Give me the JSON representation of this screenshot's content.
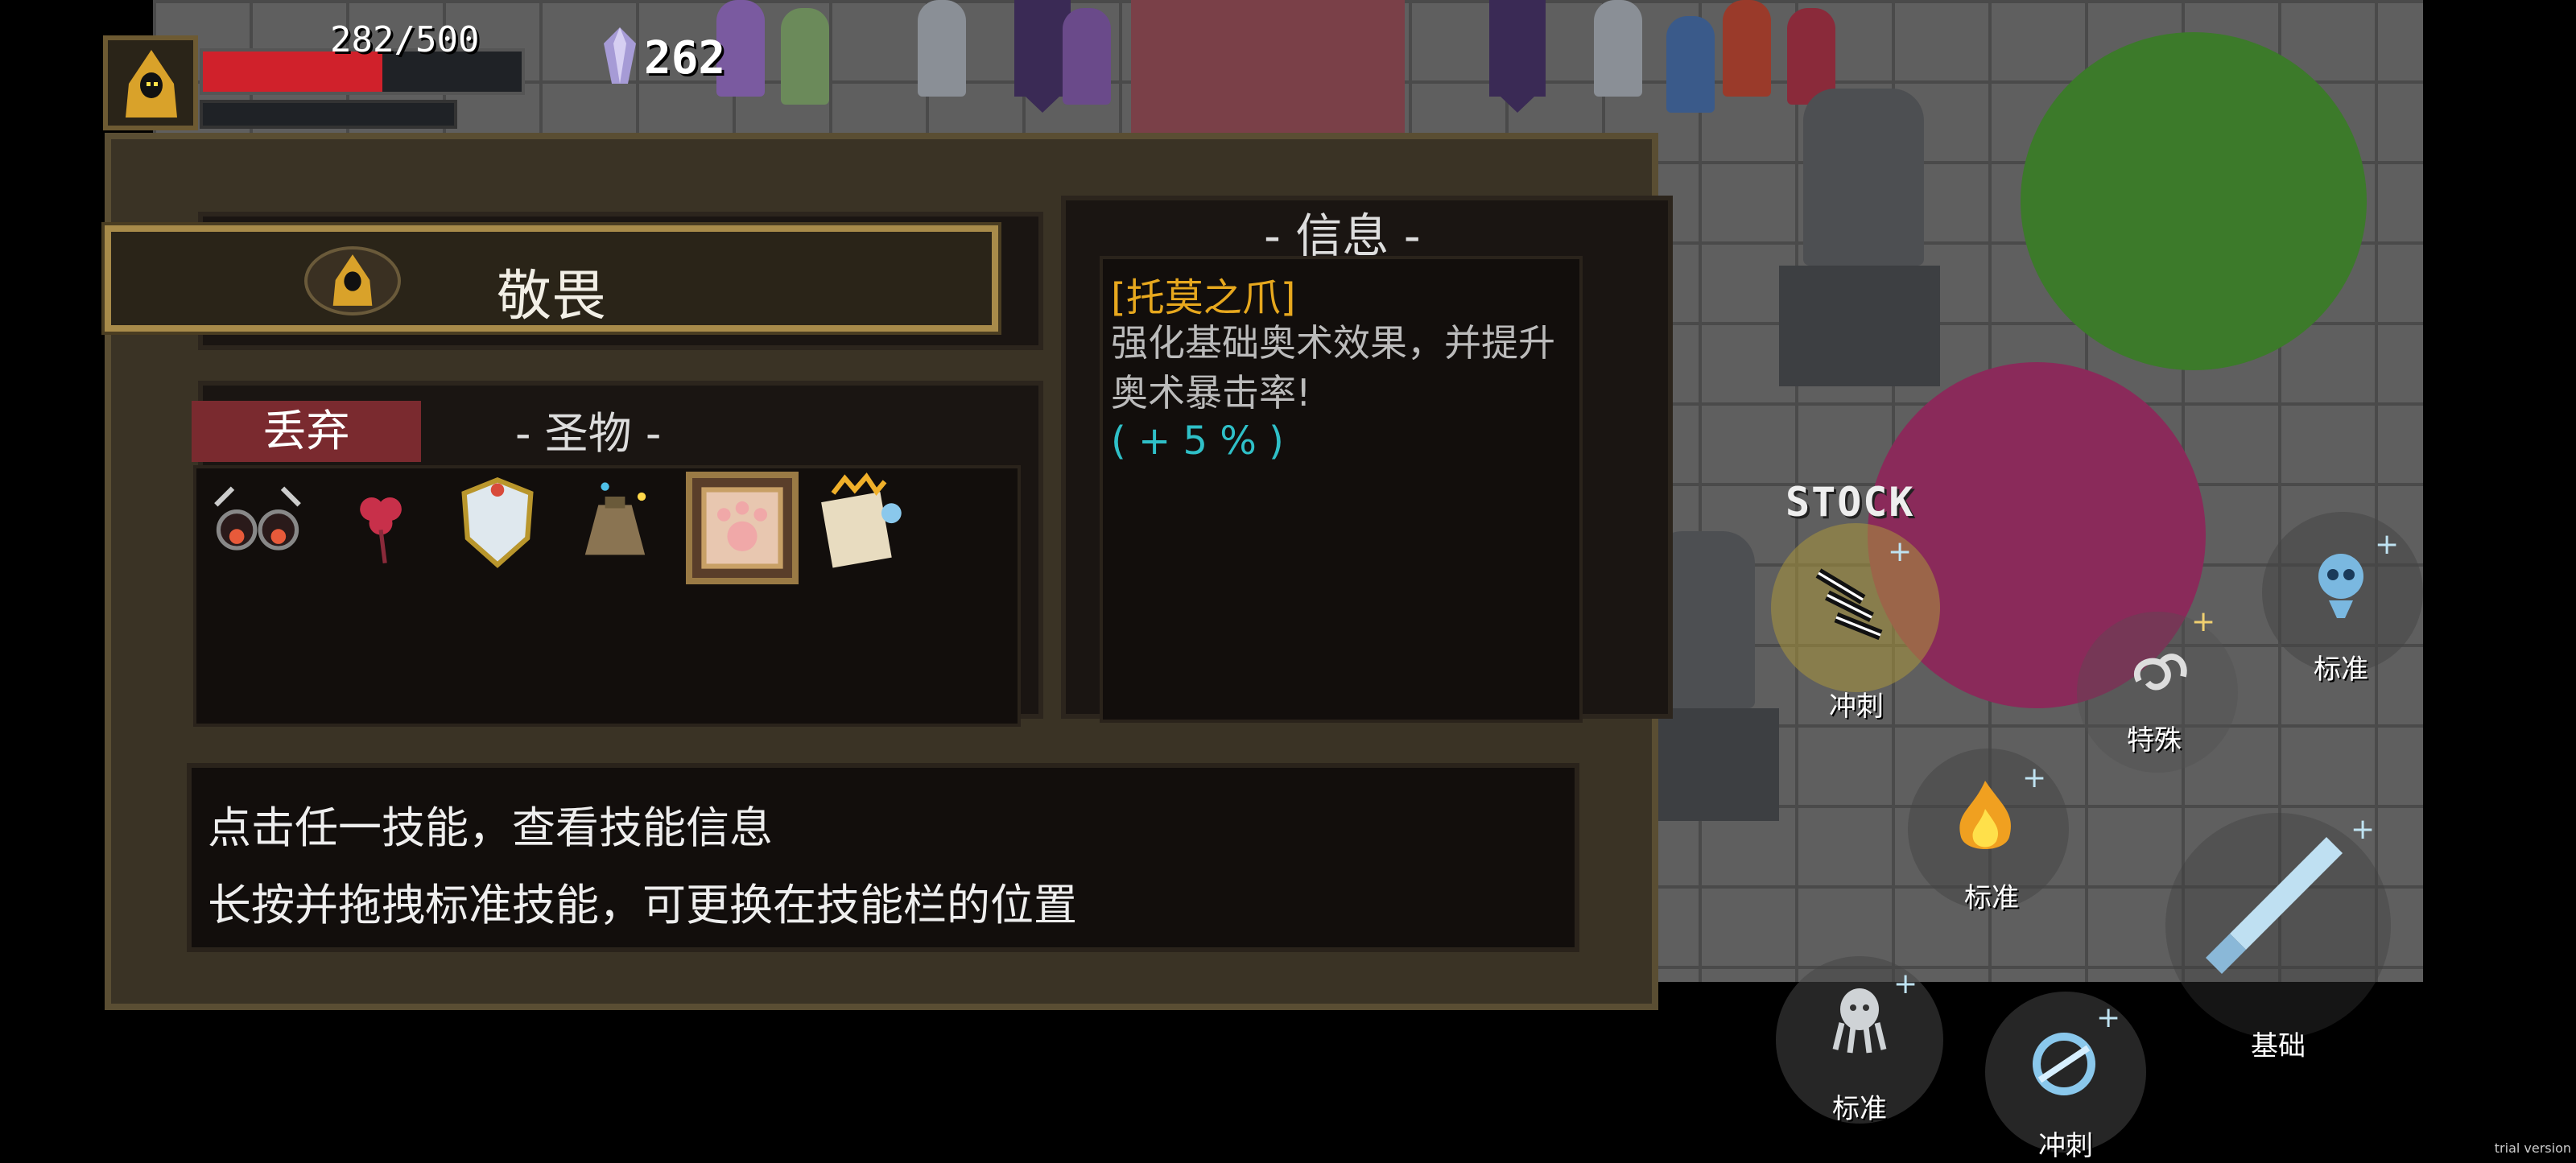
{
  "hud": {
    "hp_text": "282/500",
    "hp_fraction": 0.564,
    "gem_count": "262"
  },
  "panel": {
    "skill_name": "敬畏",
    "discard_label": "丢弃",
    "relic_title": "- 圣物 -",
    "relics": [
      {
        "icon": "glasses-icon"
      },
      {
        "icon": "flower-icon"
      },
      {
        "icon": "shield-icon"
      },
      {
        "icon": "pouch-icon"
      },
      {
        "icon": "paw-frame-icon",
        "selected": true
      },
      {
        "icon": "scroll-icon"
      }
    ],
    "info_title": "- 信息 -",
    "info_name": "[托莫之爪]",
    "info_desc": "强化基础奥术效果，并提升奥术暴击率!",
    "info_bonus": "( + 5 % )",
    "hint_line1": "点击任一技能，查看技能信息",
    "hint_line2": "长按并拖拽标准技能，可更换在技能栏的位置"
  },
  "skills": {
    "stock_label": "STOCK",
    "dash1": "冲刺",
    "special": "特殊",
    "standard1": "标准",
    "standard2": "标准",
    "basic": "基础",
    "standard3": "标准",
    "dash2": "冲刺"
  },
  "footer": {
    "trial": "trial version"
  },
  "colors": {
    "accent_gold": "#e7a81e",
    "bonus_cyan": "#2fc0c8",
    "hp_red": "#d0212b"
  }
}
